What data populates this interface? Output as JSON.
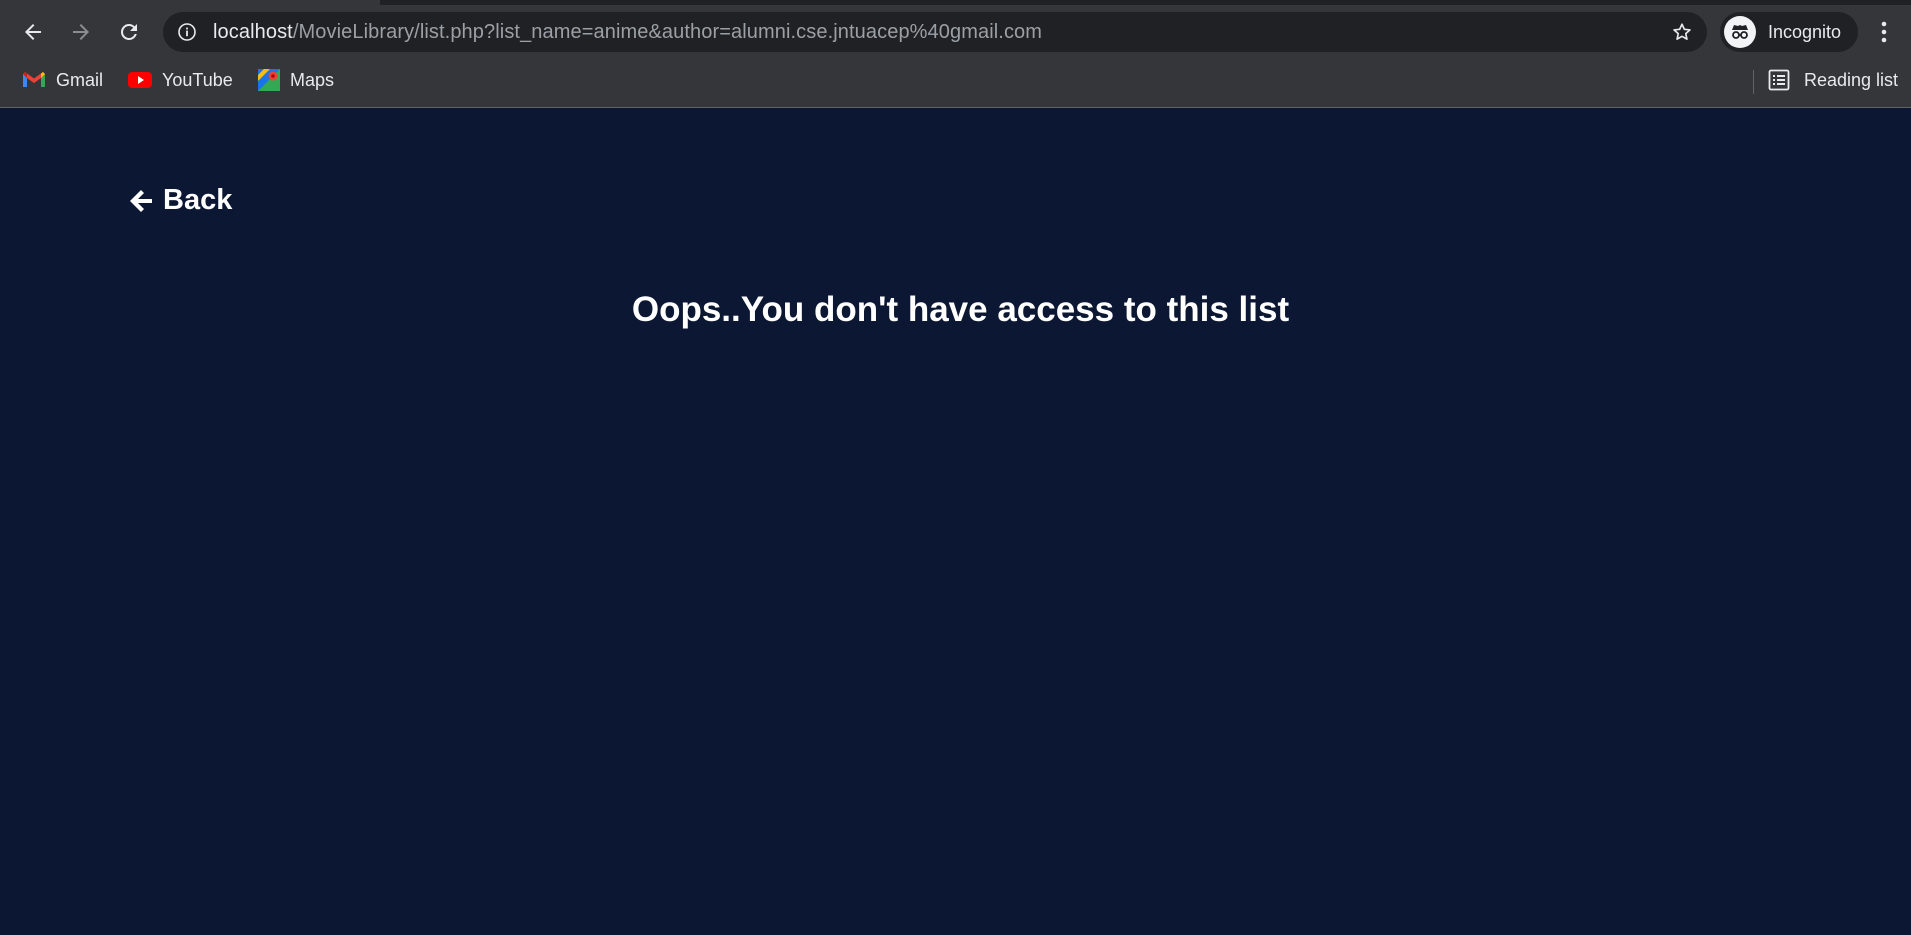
{
  "browser": {
    "url_host": "localhost",
    "url_path": "/MovieLibrary/list.php?list_name=anime&author=alumni.cse.jntuacep%40gmail.com",
    "profile_label": "Incognito",
    "bookmarks": [
      {
        "label": "Gmail",
        "icon": "gmail-icon"
      },
      {
        "label": "YouTube",
        "icon": "youtube-icon"
      },
      {
        "label": "Maps",
        "icon": "maps-icon"
      }
    ],
    "reading_list_label": "Reading list"
  },
  "page": {
    "back_label": "Back",
    "message": "Oops..You don't have access to this list"
  },
  "colors": {
    "page_background": "#0c1833",
    "browser_toolbar": "#35363a",
    "omnibox": "#202124",
    "text": "#ffffff"
  }
}
